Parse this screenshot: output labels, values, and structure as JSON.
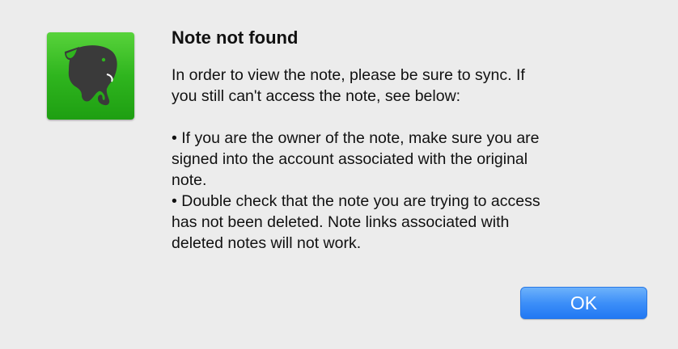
{
  "dialog": {
    "icon": "evernote-elephant-icon",
    "title": "Note not found",
    "message": {
      "lines": [
        "In order to view the note, please be sure to sync. If",
        "you still can't access the note, see below:",
        "",
        "• If you are the owner of the note, make sure you are",
        "signed into the account associated with the original",
        "note.",
        "• Double check that the note you are trying to access",
        "has not been deleted. Note links associated with",
        "deleted notes will not work."
      ]
    },
    "ok_label": "OK"
  },
  "colors": {
    "background": "#ececec",
    "icon_green": "#2fb51e",
    "button_blue": "#3d8ff8"
  }
}
